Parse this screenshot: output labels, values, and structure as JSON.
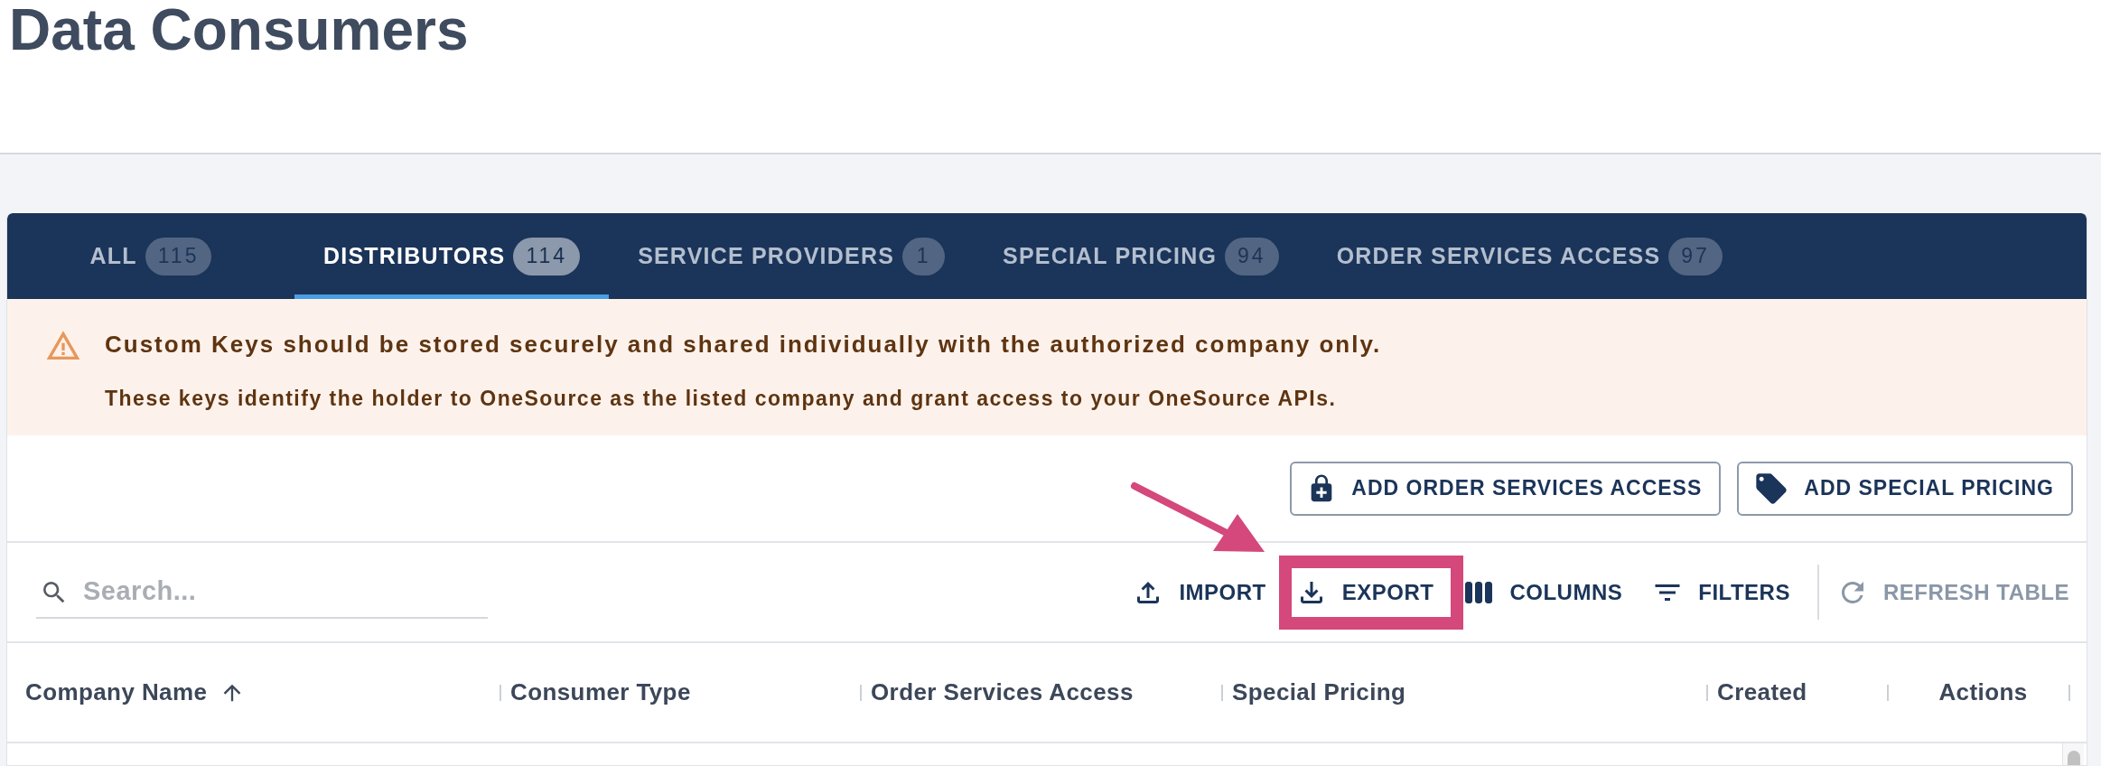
{
  "page": {
    "title": "Data Consumers"
  },
  "tabs": [
    {
      "label": "ALL",
      "count": "115",
      "selected": false
    },
    {
      "label": "DISTRIBUTORS",
      "count": "114",
      "selected": true
    },
    {
      "label": "SERVICE PROVIDERS",
      "count": "1",
      "selected": false
    },
    {
      "label": "SPECIAL PRICING",
      "count": "94",
      "selected": false
    },
    {
      "label": "ORDER SERVICES ACCESS",
      "count": "97",
      "selected": false
    }
  ],
  "alert": {
    "kind": "warning",
    "title": "Custom Keys should be stored securely and shared individually with the authorized company only.",
    "message": "These keys identify the holder to OneSource as the listed company and grant access to your OneSource APIs."
  },
  "actions": [
    "ADD ORDER SERVICES ACCESS",
    "ADD SPECIAL PRICING"
  ],
  "search": {
    "placeholder": "Search..."
  },
  "toolbar": {
    "tools": [
      {
        "label": "IMPORT",
        "highlighted": false
      },
      {
        "label": "EXPORT",
        "highlighted": true
      },
      {
        "label": "COLUMNS",
        "highlighted": false
      },
      {
        "label": "FILTERS",
        "highlighted": false
      }
    ],
    "refresh": {
      "label": "REFRESH TABLE",
      "disabled": true
    }
  },
  "table": {
    "columns": [
      {
        "label": "Company Name",
        "sorted": true
      },
      {
        "label": "Consumer Type",
        "sorted": false
      },
      {
        "label": "Order Services Access",
        "sorted": false
      },
      {
        "label": "Special Pricing",
        "sorted": false
      },
      {
        "label": "Created",
        "sorted": false
      },
      {
        "label": "Actions",
        "sorted": false
      }
    ]
  }
}
